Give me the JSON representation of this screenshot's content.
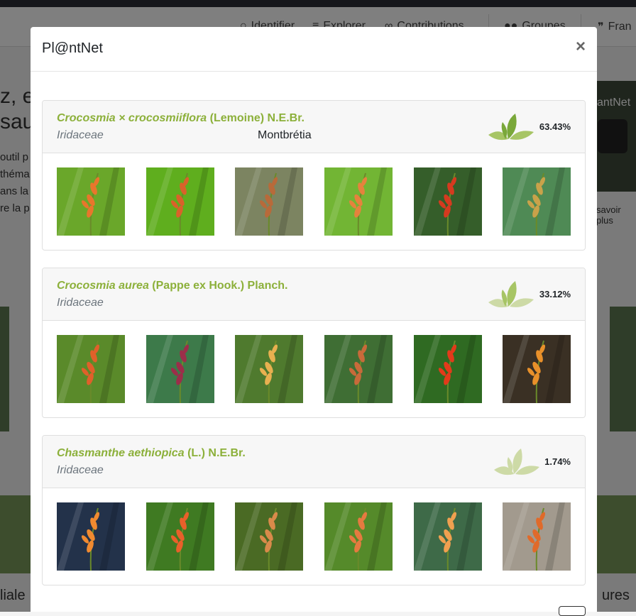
{
  "background": {
    "nav": {
      "identify": "Identifier",
      "explore": "Explorer",
      "contributions": "Contributions",
      "groups": "Groupes",
      "language": "Fran"
    },
    "hero_title_line1": "z, e",
    "hero_title_line2": "sau",
    "hero_text": [
      "outil p",
      "théma",
      "ans la",
      "re la p"
    ],
    "video_title": "antNet",
    "learn_more": "savoir plus",
    "bottom_left": "liale",
    "bottom_right": "ures"
  },
  "modal": {
    "title": "Pl@ntNet",
    "close_label": "×",
    "results": [
      {
        "genus_species": "Crocosmia × crocosmiiflora",
        "author": "(Lemoine) N.E.Br.",
        "family": "Iridaceae",
        "common_name": "Montbrétia",
        "score": "63.43%",
        "score_value": 63.43,
        "thumbs": [
          {
            "bg": "#6aa72a",
            "flower": "#e8762c"
          },
          {
            "bg": "#5fae1e",
            "flower": "#d9622a"
          },
          {
            "bg": "#7c8461",
            "flower": "#b86a3a"
          },
          {
            "bg": "#72b534",
            "flower": "#e5823d"
          },
          {
            "bg": "#355e2a",
            "flower": "#d63a1f"
          },
          {
            "bg": "#4f8a55",
            "flower": "#c9a24a"
          }
        ]
      },
      {
        "genus_species": "Crocosmia aurea",
        "author": "(Pappe ex Hook.) Planch.",
        "family": "Iridaceae",
        "common_name": "",
        "score": "33.12%",
        "score_value": 33.12,
        "thumbs": [
          {
            "bg": "#5a8a2a",
            "flower": "#e0602a"
          },
          {
            "bg": "#3d7a4a",
            "flower": "#9c2e4a"
          },
          {
            "bg": "#4f7a2e",
            "flower": "#e8b050"
          },
          {
            "bg": "#3f6e34",
            "flower": "#c86a3a"
          },
          {
            "bg": "#2f6a22",
            "flower": "#e33a1a"
          },
          {
            "bg": "#3a3024",
            "flower": "#e8902a"
          }
        ]
      },
      {
        "genus_species": "Chasmanthe aethiopica",
        "author": "(L.) N.E.Br.",
        "family": "Iridaceae",
        "common_name": "",
        "score": "1.74%",
        "score_value": 1.74,
        "thumbs": [
          {
            "bg": "#23324a",
            "flower": "#f08a30"
          },
          {
            "bg": "#3f7a22",
            "flower": "#e8602a"
          },
          {
            "bg": "#4a6a24",
            "flower": "#d98a4a"
          },
          {
            "bg": "#558a2a",
            "flower": "#e57a40"
          },
          {
            "bg": "#3e6a48",
            "flower": "#f0a050"
          },
          {
            "bg": "#a29a8e",
            "flower": "#e06a2a"
          }
        ]
      }
    ]
  },
  "colors": {
    "accent": "#8cb03a",
    "leaf_strong": "#7aa83a",
    "leaf_mid": "#a7c565",
    "leaf_light": "#cddaa6"
  }
}
